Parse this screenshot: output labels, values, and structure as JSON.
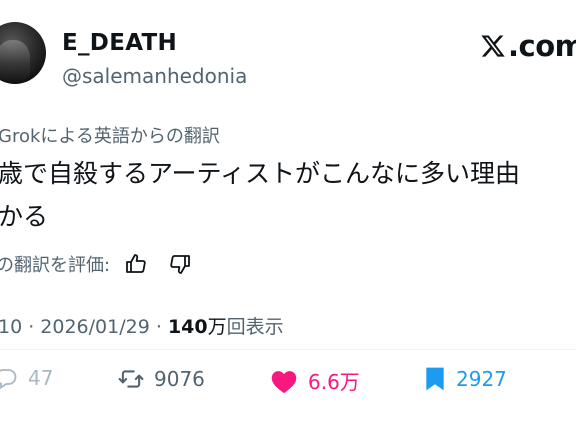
{
  "author": {
    "name": "E_DEATH",
    "handle": "@salemanhedonia"
  },
  "brand": {
    "logo_text": ".com",
    "logo_icon": "x-logo-icon"
  },
  "translation": {
    "label": "Grokによる英語からの翻訳",
    "body_line1": "歳で自殺するアーティストがこんなに多い理由",
    "body_line2": "かる",
    "rate_label": "の翻訳を評価:",
    "thumbs_up_icon": "thumbs-up-icon",
    "thumbs_down_icon": "thumbs-down-icon"
  },
  "meta": {
    "time_date": "10 · 2026/01/29 · ",
    "views_number": "140",
    "views_unit": "万",
    "views_suffix": "回表示"
  },
  "stats": {
    "replies": "47",
    "retweets": "9076",
    "likes": "6.6万",
    "bookmarks": "2927"
  },
  "colors": {
    "like": "#f91880",
    "bookmark": "#1d9bf0",
    "secondary_text": "#536471"
  }
}
